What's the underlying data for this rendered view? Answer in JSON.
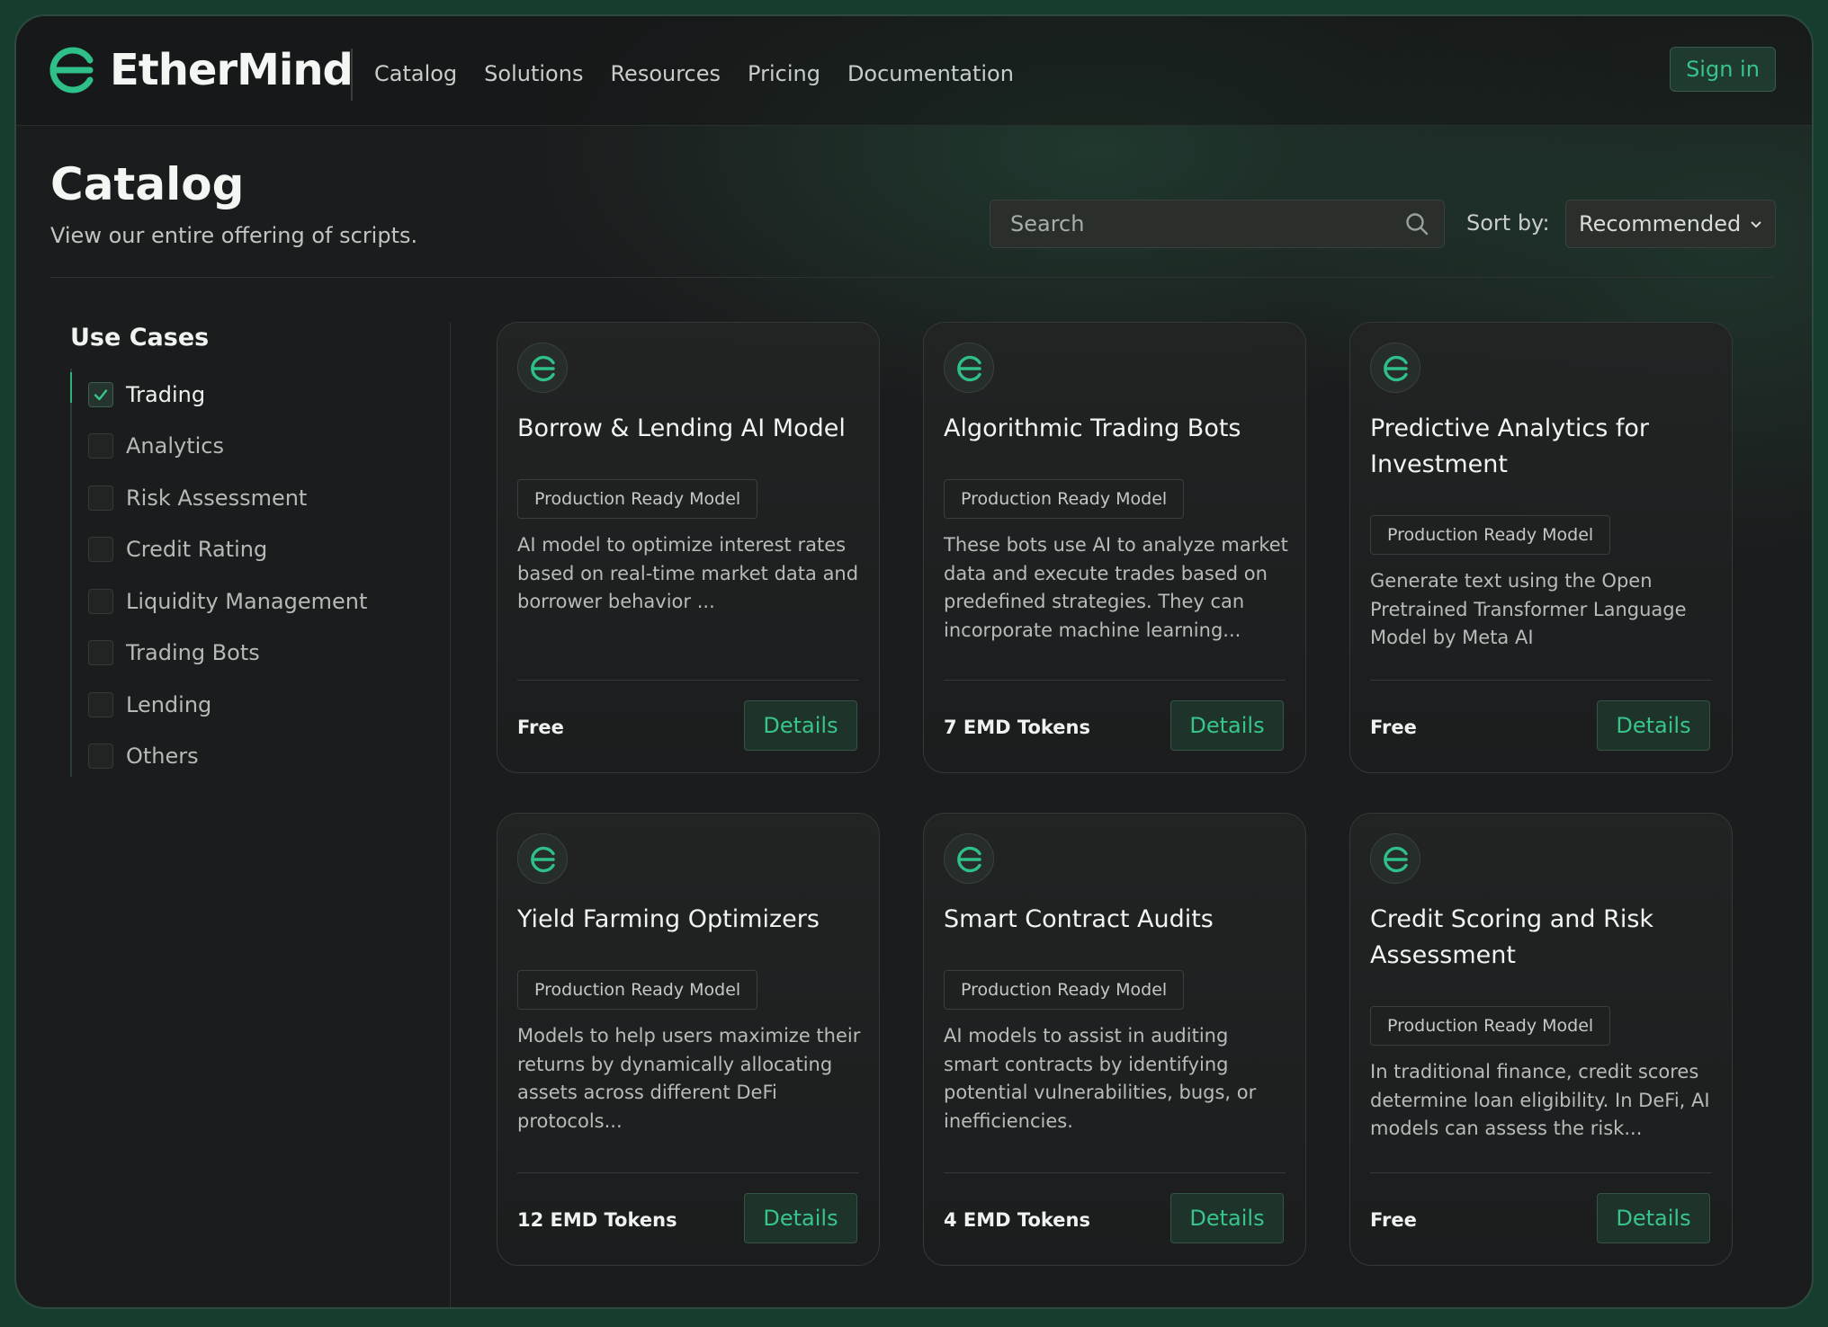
{
  "brand": {
    "name": "EtherMind",
    "accent": "#2fc08a"
  },
  "nav": {
    "items": [
      "Catalog",
      "Solutions",
      "Resources",
      "Pricing",
      "Documentation"
    ],
    "signin_label": "Sign in"
  },
  "page": {
    "title": "Catalog",
    "subtitle": "View our entire offering of scripts."
  },
  "search": {
    "placeholder": "Search",
    "icon": "search-icon"
  },
  "sort": {
    "label": "Sort by:",
    "selected": "Recommended"
  },
  "sidebar": {
    "title": "Use Cases",
    "items": [
      {
        "label": "Trading",
        "checked": true
      },
      {
        "label": "Analytics",
        "checked": false
      },
      {
        "label": "Risk Assessment",
        "checked": false
      },
      {
        "label": "Credit Rating",
        "checked": false
      },
      {
        "label": "Liquidity Management",
        "checked": false
      },
      {
        "label": "Trading Bots",
        "checked": false
      },
      {
        "label": "Lending",
        "checked": false
      },
      {
        "label": "Others",
        "checked": false
      }
    ]
  },
  "cards": [
    {
      "title": "Borrow & Lending AI Model",
      "tag": "Production Ready Model",
      "description": "AI model to optimize interest rates based on real-time market data and borrower behavior ...",
      "price": "Free",
      "button": "Details"
    },
    {
      "title": "Algorithmic Trading Bots",
      "tag": "Production Ready Model",
      "description": "These bots use AI to analyze market data and execute trades based on predefined strategies. They can incorporate machine learning...",
      "price": "7 EMD Tokens",
      "button": "Details"
    },
    {
      "title": "Predictive Analytics for Investment",
      "tag": "Production Ready Model",
      "description": "Generate text using the Open Pretrained Transformer Language Model by Meta AI",
      "price": "Free",
      "button": "Details"
    },
    {
      "title": "Yield Farming Optimizers",
      "tag": "Production Ready Model",
      "description": "Models to help users maximize their returns by dynamically allocating assets across different DeFi protocols...",
      "price": "12 EMD Tokens",
      "button": "Details"
    },
    {
      "title": "Smart Contract Audits",
      "tag": "Production Ready Model",
      "description": "AI models to assist in auditing smart contracts by identifying potential vulnerabilities, bugs, or inefficiencies.",
      "price": "4 EMD Tokens",
      "button": "Details"
    },
    {
      "title": "Credit Scoring and Risk Assessment",
      "tag": "Production Ready Model",
      "description": "In traditional finance, credit scores determine loan eligibility. In DeFi, AI models can assess the risk...",
      "price": "Free",
      "button": "Details"
    }
  ]
}
